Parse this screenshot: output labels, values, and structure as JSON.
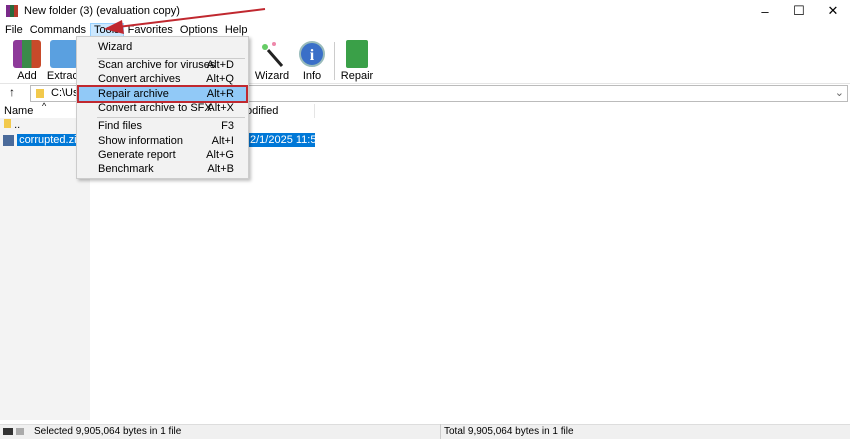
{
  "window": {
    "title": "New folder (3) (evaluation copy)",
    "minimize": "–",
    "maximize": "☐",
    "close": "✕"
  },
  "menubar": [
    "File",
    "Commands",
    "Tools",
    "Favorites",
    "Options",
    "Help"
  ],
  "toolbar": {
    "add": "Add",
    "extract": "Extract",
    "wizard": "Wizard",
    "info": "Info",
    "repair": "Repair"
  },
  "address": {
    "path": "C:\\Use",
    "up": "↑",
    "dropdown": "⌄"
  },
  "columns": {
    "name": "Name",
    "modified": "odified",
    "sort": "^"
  },
  "files": [
    {
      "name": "..",
      "modified": ""
    },
    {
      "name": "corrupted.zip",
      "modified": "2/1/2025 11:5..."
    }
  ],
  "tools_menu": [
    {
      "label": "Wizard",
      "key": ""
    },
    {
      "label": "Scan archive for viruses",
      "key": "Alt+D"
    },
    {
      "label": "Convert archives",
      "key": "Alt+Q"
    },
    {
      "label": "Repair archive",
      "key": "Alt+R"
    },
    {
      "label": "Convert archive to SFX",
      "key": "Alt+X"
    },
    {
      "label": "Find files",
      "key": "F3"
    },
    {
      "label": "Show information",
      "key": "Alt+I"
    },
    {
      "label": "Generate report",
      "key": "Alt+G"
    },
    {
      "label": "Benchmark",
      "key": "Alt+B"
    }
  ],
  "status": {
    "left": "Selected 9,905,064 bytes in 1 file",
    "right": "Total 9,905,064 bytes in 1 file"
  },
  "colors": {
    "highlight": "#91c9f7",
    "annotation": "#c0282f",
    "selection": "#0078d7"
  }
}
